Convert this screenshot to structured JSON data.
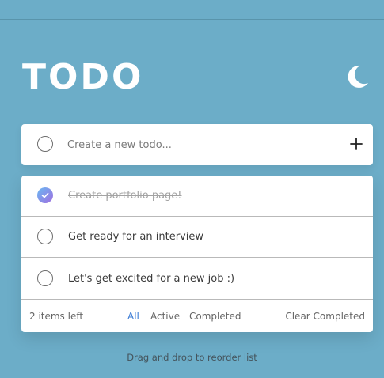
{
  "header": {
    "title": "TODO",
    "theme_icon": "moon-icon"
  },
  "new_todo": {
    "placeholder": "Create a new todo...",
    "add_icon": "plus-icon"
  },
  "todos": [
    {
      "text": "Create portfolio page!",
      "completed": true
    },
    {
      "text": "Get ready for an interview",
      "completed": false
    },
    {
      "text": "Let's get excited for a new job :)",
      "completed": false
    }
  ],
  "footer": {
    "items_left": "2 items left",
    "filters": {
      "all": "All",
      "active": "Active",
      "completed": "Completed"
    },
    "active_filter": "All",
    "clear_completed": "Clear Completed"
  },
  "hint": "Drag and drop to reorder list",
  "colors": {
    "background": "#6cadc8",
    "card": "#ffffff",
    "accent": "#3a7bd5",
    "check_gradient_start": "#6ab8f2",
    "check_gradient_end": "#a06ee0"
  }
}
